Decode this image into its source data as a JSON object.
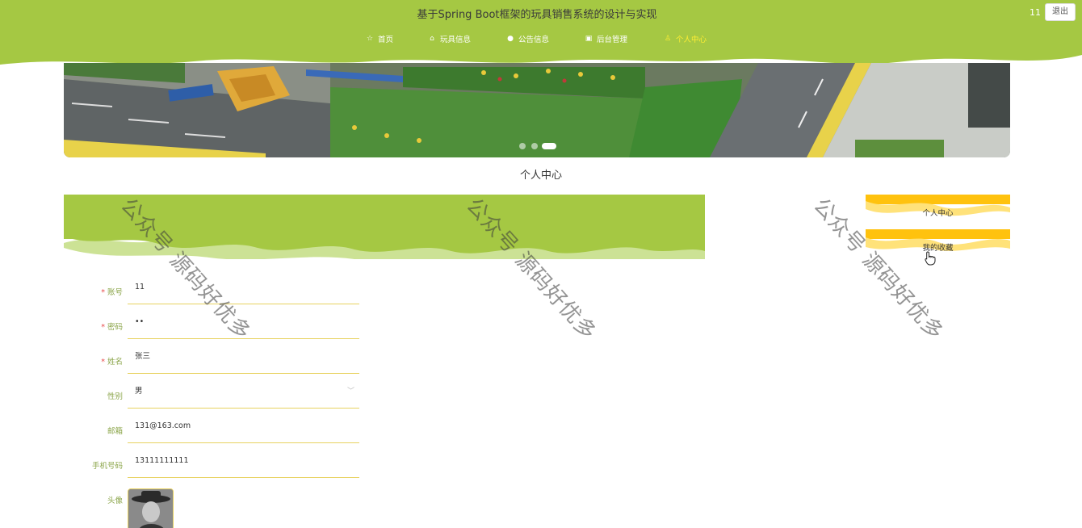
{
  "header": {
    "title": "基于Spring Boot框架的玩具销售系统的设计与实现",
    "username": "11",
    "logout_label": "退出",
    "nav": [
      {
        "label": "首页",
        "icon": "star-icon",
        "active": false
      },
      {
        "label": "玩具信息",
        "icon": "bag-icon",
        "active": false
      },
      {
        "label": "公告信息",
        "icon": "info-icon",
        "active": false
      },
      {
        "label": "后台管理",
        "icon": "shop-icon",
        "active": false
      },
      {
        "label": "个人中心",
        "icon": "user-icon",
        "active": true
      }
    ]
  },
  "banner": {
    "slide_count": 3,
    "active_slide": 3
  },
  "section_title": "个人中心",
  "form": {
    "fields": [
      {
        "label": "账号",
        "required": true,
        "value": "11"
      },
      {
        "label": "密码",
        "required": true,
        "value": "••"
      },
      {
        "label": "姓名",
        "required": true,
        "value": "张三"
      },
      {
        "label": "性别",
        "required": false,
        "value": "男"
      },
      {
        "label": "邮箱",
        "required": false,
        "value": "131@163.com"
      },
      {
        "label": "手机号码",
        "required": false,
        "value": "13111111111"
      }
    ],
    "avatar_label": "头像"
  },
  "side_menu": [
    {
      "label": "个人中心"
    },
    {
      "label": "我的收藏"
    }
  ],
  "watermark": "公众号 源码好优多",
  "colors": {
    "primary": "#a5c843",
    "accent": "#ffc20e",
    "accent_light": "#ffe27a",
    "field_border": "#e8d260",
    "active_nav": "#ffee33"
  }
}
